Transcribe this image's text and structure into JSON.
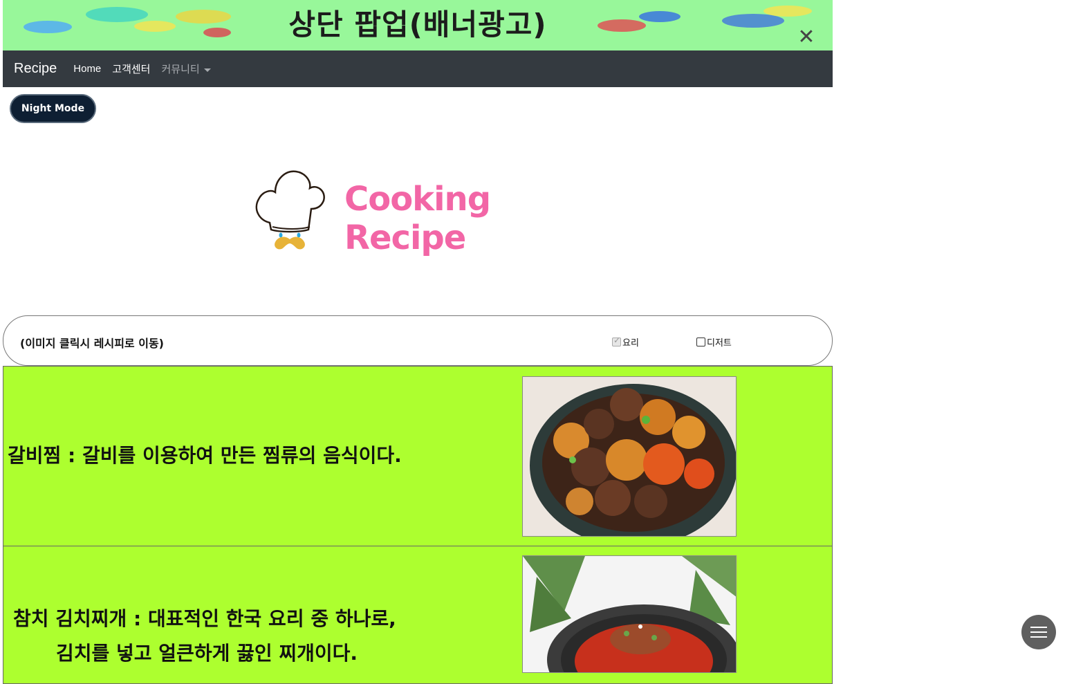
{
  "banner": {
    "title": "상단 팝업(배너광고)",
    "close_icon": "close-icon"
  },
  "navbar": {
    "brand": "Recipe",
    "links": [
      {
        "label": "Home"
      },
      {
        "label": "고객센터"
      },
      {
        "label": "커뮤니티"
      }
    ]
  },
  "night_mode": {
    "label": "Night Mode"
  },
  "logo": {
    "text": "Cooking Recipe",
    "icon": "chef-hat-icon"
  },
  "filter": {
    "hint": "(이미지 클릭시 레시피로 이동)",
    "options": [
      {
        "label": "요리",
        "checked": true
      },
      {
        "label": "디저트",
        "checked": false
      }
    ]
  },
  "recipes": [
    {
      "text": "갈비찜 : 갈비를 이용하여 만든 찜류의 음식이다."
    },
    {
      "line1": "참치 김치찌개 : 대표적인 한국 요리 중 하나로,",
      "line2": "김치를 넣고 얼큰하게 끓인 찌개이다."
    }
  ],
  "fab": {
    "icon": "hamburger-menu-icon"
  },
  "colors": {
    "banner_bg": "#98f79a",
    "navbar_bg": "#343a40",
    "row_bg": "#adff2f",
    "logo_pink": "#f266a6"
  }
}
